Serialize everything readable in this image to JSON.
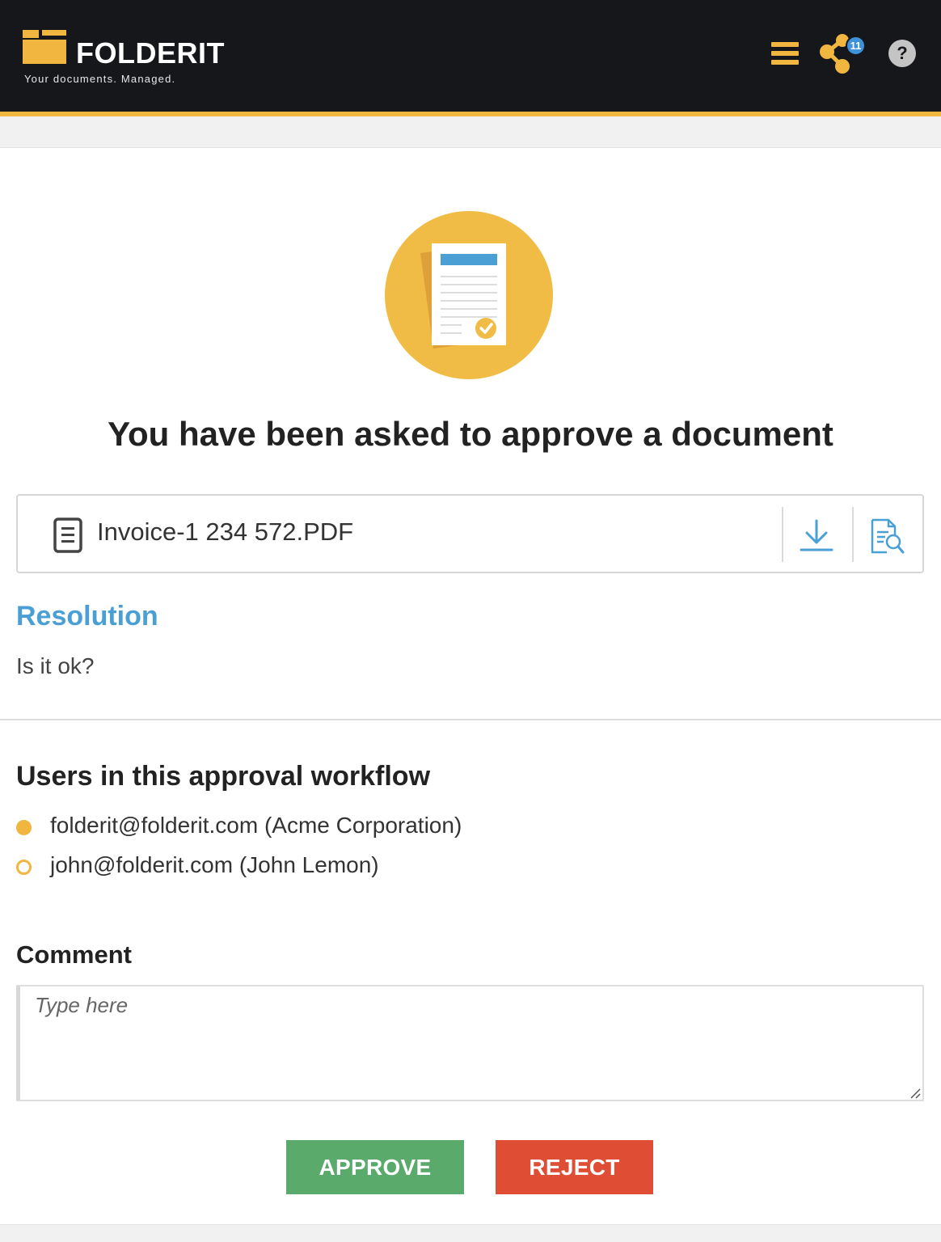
{
  "brand": {
    "name": "FOLDERIT",
    "tagline": "Your documents. Managed."
  },
  "header": {
    "share_badge_count": "11",
    "help_label": "?"
  },
  "request": {
    "headline": "You have been asked to approve a document",
    "document_name": "Invoice-1 234 572.PDF"
  },
  "resolution": {
    "title": "Resolution",
    "text": "Is it ok?"
  },
  "workflow": {
    "title": "Users in this approval workflow",
    "users": [
      {
        "label": "folderit@folderit.com (Acme Corporation)",
        "status": "filled"
      },
      {
        "label": "john@folderit.com (John Lemon)",
        "status": "hollow"
      }
    ]
  },
  "comment": {
    "title": "Comment",
    "placeholder": "Type here",
    "value": ""
  },
  "actions": {
    "approve_label": "APPROVE",
    "reject_label": "REJECT"
  },
  "colors": {
    "accent": "#f0b63f",
    "header_bg": "#15171b",
    "link_blue": "#4a9fd5",
    "approve": "#5aaa6b",
    "reject": "#e04d35"
  },
  "icons": {
    "logo": "folder-icon",
    "menu": "hamburger-menu-icon",
    "share": "share-icon",
    "help": "help-icon",
    "hero": "document-approval-icon",
    "file": "file-icon",
    "download": "download-icon",
    "preview": "preview-document-icon"
  }
}
